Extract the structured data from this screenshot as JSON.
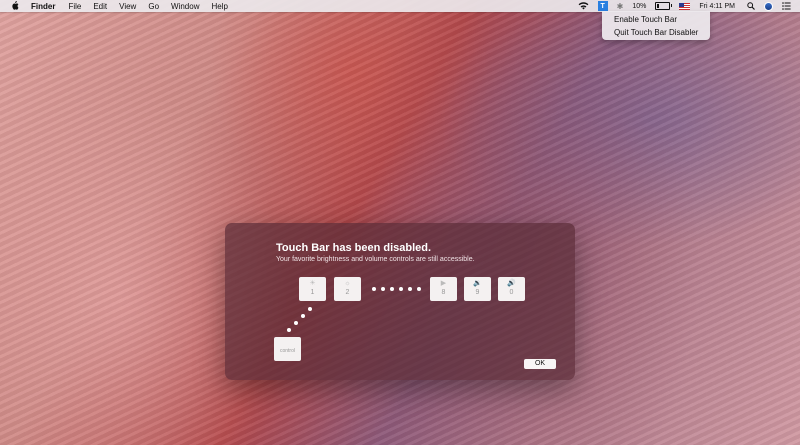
{
  "menubar": {
    "app_name": "Finder",
    "menus": [
      "File",
      "Edit",
      "View",
      "Go",
      "Window",
      "Help"
    ],
    "battery_percent": "10%",
    "touchbar_icon": "T",
    "clock": "Fri 4:11 PM",
    "status_icons": [
      "wifi-icon",
      "touchbar-disabler-icon",
      "bluetooth-icon",
      "battery-icon",
      "us-flag-icon",
      "spotlight-icon",
      "user-icon",
      "notification-center-icon"
    ]
  },
  "dropdown": {
    "items": [
      "Enable Touch Bar",
      "Quit Touch Bar Disabler"
    ]
  },
  "dialog": {
    "title": "Touch Bar has been disabled.",
    "subtitle": "Your favorite brightness and volume controls are still accessible.",
    "keys": [
      {
        "label": "1",
        "icon": "brightness-down-icon"
      },
      {
        "label": "2",
        "icon": "brightness-up-icon"
      },
      {
        "label": "8",
        "icon": "play-pause-icon"
      },
      {
        "label": "9",
        "icon": "volume-down-icon"
      },
      {
        "label": "0",
        "icon": "volume-up-icon"
      }
    ],
    "modifier_key": "control",
    "ok_label": "OK"
  },
  "colors": {
    "accent": "#2a7fe0",
    "dialog_bg": "#5a2d37"
  }
}
